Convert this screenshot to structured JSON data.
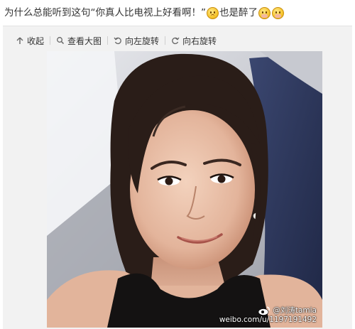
{
  "post": {
    "text_before": "为什么总能听到这句“你真人比电视上好看啊！”",
    "text_after": "也是醉了"
  },
  "toolbar": {
    "collapse_label": "收起",
    "view_large_label": "查看大图",
    "rotate_left_label": "向左旋转",
    "rotate_right_label": "向右旋转"
  },
  "photo": {
    "description_icon": "selfie-photo",
    "watermark_user": "@刘涛tamia",
    "watermark_url": "weibo.com/u/1197191492"
  },
  "colors": {
    "toolbar_bg": "#f2f2f2",
    "text": "#333333"
  }
}
